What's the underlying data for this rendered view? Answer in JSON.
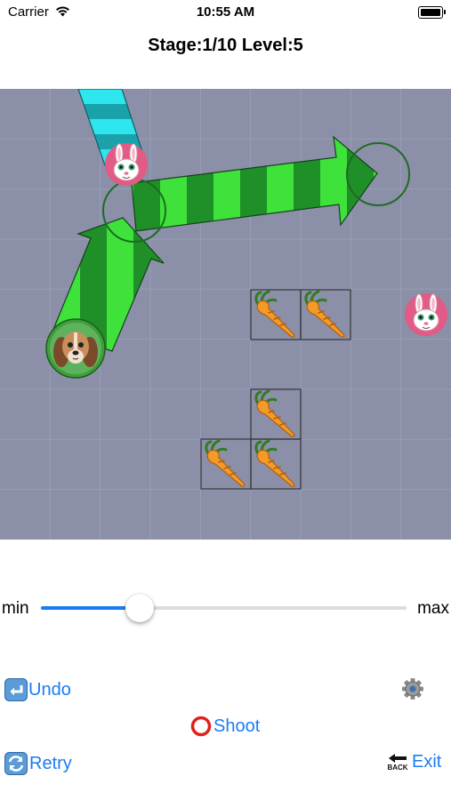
{
  "status_bar": {
    "carrier": "Carrier",
    "time": "10:55 AM"
  },
  "header": {
    "title": "Stage:1/10 Level:5"
  },
  "board": {
    "grid_cells": 9,
    "background_color": "#8b8fa8",
    "grid_line_color": "#9a9fb8",
    "pieces": {
      "dog": "dog-face",
      "bunnies": [
        "bunny-face",
        "bunny-face"
      ],
      "carrots": [
        "carrot",
        "carrot",
        "carrot",
        "carrot",
        "carrot"
      ]
    },
    "colors": {
      "green_light": "#3ee23a",
      "green_dark": "#1f8f27",
      "cyan_light": "#2ee6ee",
      "cyan_dark": "#1aa2aa",
      "bunny_pink": "#e25a86"
    }
  },
  "slider": {
    "min_label": "min",
    "max_label": "max",
    "value_fraction": 0.27
  },
  "controls": {
    "undo": {
      "label": "Undo",
      "icon": "undo-icon"
    },
    "settings": {
      "icon": "gear-icon"
    },
    "shoot": {
      "label": "Shoot",
      "icon": "red-circle-icon"
    },
    "retry": {
      "label": "Retry",
      "icon": "retry-icon"
    },
    "exit": {
      "label": "Exit",
      "icon": "back-arrow-icon",
      "icon_text": "BACK"
    }
  }
}
